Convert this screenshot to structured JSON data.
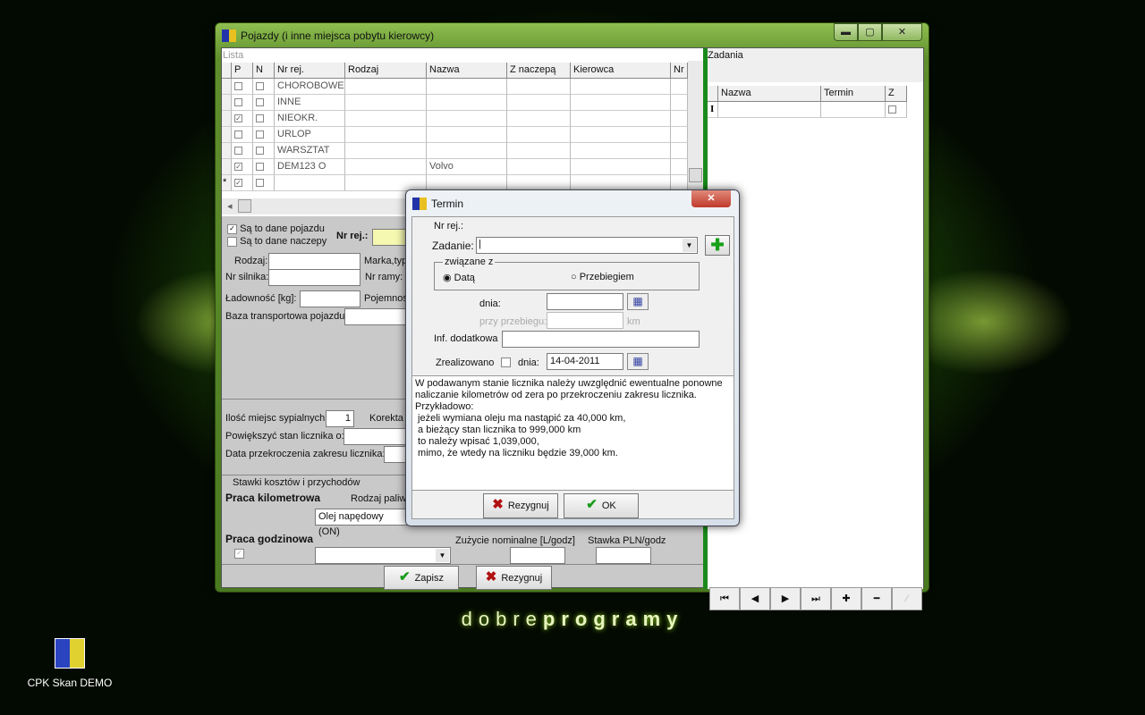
{
  "window": {
    "title": "Pojazdy (i inne miejsca pobytu kierowcy)",
    "minimize": "▬",
    "maximize": "▢",
    "close": "✕"
  },
  "list": {
    "label": "Lista",
    "columns": [
      "P",
      "N",
      "Nr rej.",
      "Rodzaj",
      "Nazwa",
      "Z naczepą",
      "Kierowca",
      "Nr"
    ],
    "rows": [
      {
        "p": false,
        "n": false,
        "nr": "CHOROBOWE",
        "nazwa": ""
      },
      {
        "p": false,
        "n": false,
        "nr": "INNE",
        "nazwa": ""
      },
      {
        "p": true,
        "n": false,
        "nr": "NIEOKR.",
        "nazwa": ""
      },
      {
        "p": false,
        "n": false,
        "nr": "URLOP",
        "nazwa": ""
      },
      {
        "p": false,
        "n": false,
        "nr": "WARSZTAT",
        "nazwa": ""
      },
      {
        "p": true,
        "n": false,
        "nr": "DEM123 O",
        "nazwa": "Volvo"
      },
      {
        "p": true,
        "n": false,
        "nr": "",
        "nazwa": "",
        "new": "*"
      }
    ]
  },
  "form": {
    "vehicle_data": "Są to dane pojazdu",
    "trailer_data": "Są to dane naczepy",
    "nr_rej": "Nr rej.:",
    "rodzaj": "Rodzaj:",
    "marka": "Marka,typ",
    "nr_silnika": "Nr silnika:",
    "nr_ramy": "Nr ramy:",
    "ladownosc": "Ładowność [kg]:",
    "pojemnosc": "Pojemność",
    "baza": "Baza transportowa pojazdu:",
    "miejsca": "Ilość miejsc sypialnych",
    "miejsca_value": "1",
    "korekta": "Korekta",
    "powiekszyc": "Powiększyć stan licznika o:",
    "data_przekroczenia": "Data przekroczenia zakresu licznika:",
    "stawki": "Stawki kosztów i przychodów",
    "praca_km": "Praca kilometrowa",
    "rodzaj_paliwa": "Rodzaj paliwa",
    "paliwo_value": "Olej napędowy (ON)",
    "praca_godz": "Praca godzinowa",
    "zuzycie": "Zużycie nominalne [L/godz]",
    "stawka": "Stawka PLN/godz",
    "save": "Zapisz",
    "cancel": "Rezygnuj"
  },
  "tasks": {
    "label": "Zadania",
    "columns": [
      "Nazwa",
      "Termin",
      "Z"
    ],
    "cursor": "I",
    "nav": [
      "⏮",
      "◀",
      "▶",
      "⏭",
      "✚",
      "━",
      "⁄"
    ]
  },
  "dialog": {
    "title": "Termin",
    "nr_rej": "Nr rej.:",
    "zadanie": "Zadanie:",
    "group": "związane z",
    "radio_data": "Datą",
    "radio_przebieg": "Przebiegiem",
    "dnia": "dnia:",
    "przy_przebiegu": "przy przebiegu:",
    "km": "km",
    "inf": "Inf. dodatkowa",
    "zrealizowano": "Zrealizowano",
    "dnia2": "dnia:",
    "date_value": "14-04-2011",
    "note": [
      "W podawanym stanie licznika należy uwzględnić ewentualne ponowne",
      "naliczanie kilometrów od zera po przekroczeniu zakresu licznika.",
      "Przykładowo:",
      " jeżeli wymiana oleju ma nastąpić za 40,000 km,",
      " a bieżący stan licznika to 999,000 km",
      " to należy wpisać 1,039,000,",
      " mimo, że wtedy na liczniku będzie 39,000 km."
    ],
    "cancel": "Rezygnuj",
    "ok": "OK",
    "close": "✕"
  },
  "brand": {
    "a": "dobre",
    "b": "programy"
  },
  "desktop": {
    "icon_label": "CPK Skan DEMO"
  }
}
